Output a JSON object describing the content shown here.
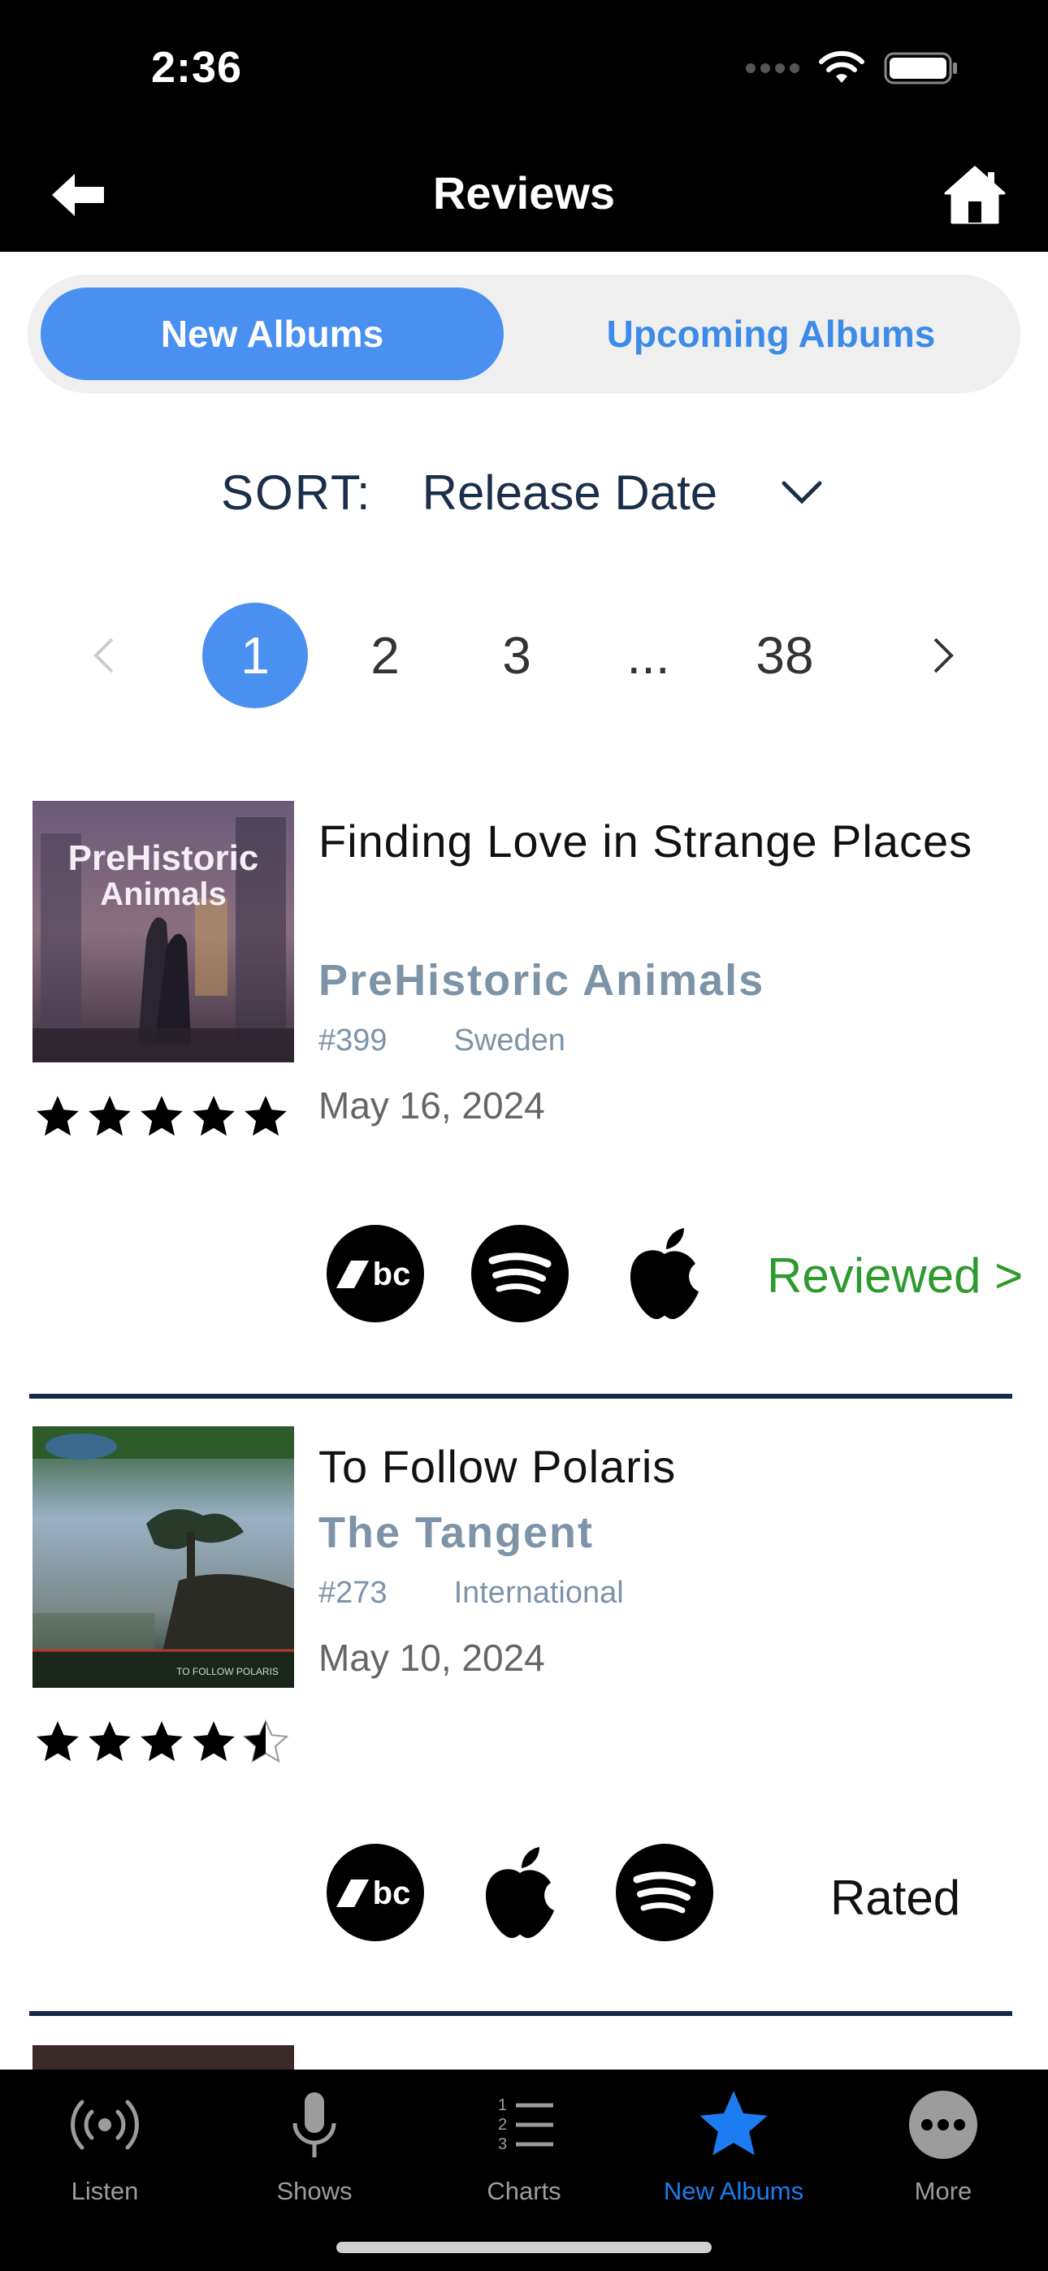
{
  "status_bar": {
    "time": "2:36"
  },
  "nav": {
    "title": "Reviews"
  },
  "segments": {
    "active": "New Albums",
    "inactive": "Upcoming Albums"
  },
  "sort": {
    "label": "SORT:",
    "value": "Release Date"
  },
  "pagination": {
    "pages": [
      "1",
      "2",
      "3",
      "...",
      "38"
    ],
    "current": "1"
  },
  "reviews": [
    {
      "title": "Finding Love in Strange Places",
      "artist": "PreHistoric Animals",
      "rank": "#399",
      "country": "Sweden",
      "date": "May 16, 2024",
      "rating": 5,
      "cover_text": "PreHistoric Animals",
      "platforms": [
        "bandcamp-icon",
        "spotify-icon",
        "apple-icon"
      ],
      "status": "Reviewed >",
      "status_color": "#2e9a2e"
    },
    {
      "title": "To Follow Polaris",
      "artist": "The Tangent",
      "rank": "#273",
      "country": "International",
      "date": "May 10, 2024",
      "rating": 4.5,
      "cover_text": "TO FOLLOW POLARIS",
      "platforms": [
        "bandcamp-icon",
        "apple-icon",
        "spotify-icon"
      ],
      "status": "Rated",
      "status_color": "#111111"
    }
  ],
  "tabs": [
    {
      "label": "Listen",
      "icon": "broadcast-icon"
    },
    {
      "label": "Shows",
      "icon": "microphone-icon"
    },
    {
      "label": "Charts",
      "icon": "numbered-list-icon"
    },
    {
      "label": "New Albums",
      "icon": "star-icon",
      "active": true
    },
    {
      "label": "More",
      "icon": "ellipsis-icon"
    }
  ],
  "colors": {
    "accent": "#4a90f0",
    "tab_active": "#1e7cf2",
    "divider": "#14294a",
    "artist": "#7d93a8"
  }
}
